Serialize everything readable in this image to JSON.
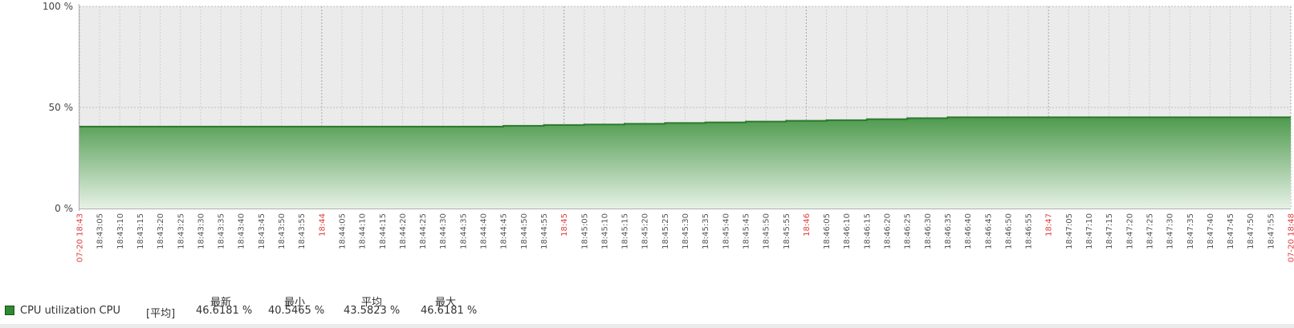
{
  "chart_data": {
    "type": "area",
    "y_axis": {
      "min": 0,
      "max": 100,
      "unit": "%",
      "labels": [
        "0 %",
        "50 %",
        "100 %"
      ]
    },
    "x_labels": [
      "07-20 18:43",
      "18:43:05",
      "18:43:10",
      "18:43:15",
      "18:43:20",
      "18:43:25",
      "18:43:30",
      "18:43:35",
      "18:43:40",
      "18:43:45",
      "18:43:50",
      "18:43:55",
      "18:44",
      "18:44:05",
      "18:44:10",
      "18:44:15",
      "18:44:20",
      "18:44:25",
      "18:44:30",
      "18:44:35",
      "18:44:40",
      "18:44:45",
      "18:44:50",
      "18:44:55",
      "18:45",
      "18:45:05",
      "18:45:10",
      "18:45:15",
      "18:45:20",
      "18:45:25",
      "18:45:30",
      "18:45:35",
      "18:45:40",
      "18:45:45",
      "18:45:50",
      "18:45:55",
      "18:46",
      "18:46:05",
      "18:46:10",
      "18:46:15",
      "18:46:20",
      "18:46:25",
      "18:46:30",
      "18:46:35",
      "18:46:40",
      "18:46:45",
      "18:46:50",
      "18:46:55",
      "18:47",
      "18:47:05",
      "18:47:10",
      "18:47:15",
      "18:47:20",
      "18:47:25",
      "18:47:30",
      "18:47:35",
      "18:47:40",
      "18:47:45",
      "18:47:50",
      "18:47:55",
      "07-20 18:48"
    ],
    "highlighted_labels": [
      "07-20 18:43",
      "18:44",
      "18:45",
      "18:46",
      "18:47",
      "07-20 18:48"
    ],
    "series": [
      {
        "name": "CPU utilization CPU",
        "color": "#2e8b2e",
        "values": [
          40.5,
          40.5,
          40.5,
          40.5,
          40.5,
          40.5,
          40.5,
          40.5,
          40.5,
          40.5,
          40.5,
          40.5,
          40.5,
          40.5,
          40.5,
          40.5,
          40.5,
          40.5,
          40.5,
          40.5,
          40.5,
          40.9,
          40.9,
          41.3,
          41.3,
          41.6,
          41.6,
          41.9,
          41.9,
          42.3,
          42.3,
          42.6,
          42.6,
          43.0,
          43.0,
          43.4,
          43.4,
          43.7,
          43.7,
          44.2,
          44.2,
          44.7,
          44.7,
          45.1,
          45.1,
          45.1,
          45.1,
          45.1,
          45.1,
          45.1,
          45.1,
          45.1,
          45.1,
          45.1,
          45.1,
          45.1,
          45.1,
          45.1,
          45.1,
          45.1,
          45.1
        ]
      }
    ]
  },
  "legend": {
    "headers": [
      "最新",
      "最小",
      "平均",
      "最大"
    ],
    "items": [
      {
        "name": "CPU utilization CPU",
        "func": "[平均]",
        "last": "46.6181 %",
        "min": "40.5465 %",
        "avg": "43.5823 %",
        "max": "46.6181 %"
      }
    ]
  }
}
